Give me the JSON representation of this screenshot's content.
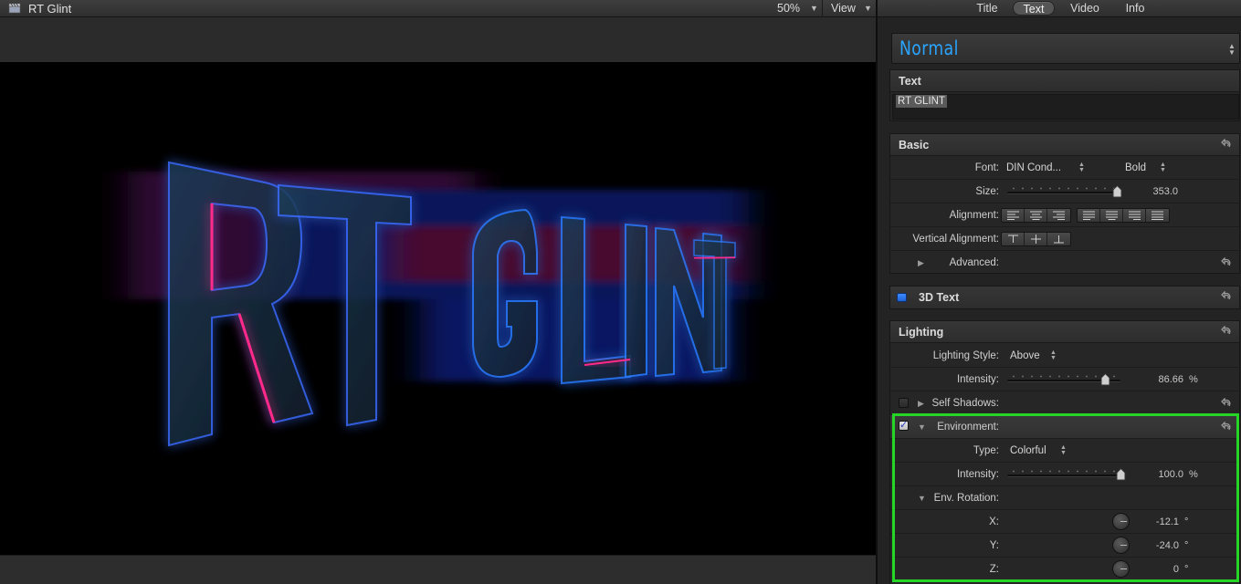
{
  "viewer": {
    "title": "RT Glint",
    "zoom": "50%",
    "view_label": "View",
    "canvas_text": "RT GLINT"
  },
  "inspector": {
    "tabs": [
      {
        "label": "Title",
        "active": false
      },
      {
        "label": "Text",
        "active": true
      },
      {
        "label": "Video",
        "active": false
      },
      {
        "label": "Info",
        "active": false
      }
    ],
    "style_preset": "Normal",
    "text_section": {
      "title": "Text",
      "content": "RT GLINT"
    },
    "basic": {
      "title": "Basic",
      "font_label": "Font:",
      "font_value": "DIN Cond...",
      "weight_value": "Bold",
      "size_label": "Size:",
      "size_value": "353.0",
      "size_fraction": 0.97,
      "alignment_label": "Alignment:",
      "vertical_alignment_label": "Vertical Alignment:",
      "advanced_label": "Advanced:"
    },
    "three_d_text": {
      "title": "3D Text",
      "enabled": true
    },
    "lighting": {
      "title": "Lighting",
      "style_label": "Lighting Style:",
      "style_value": "Above",
      "intensity_label": "Intensity:",
      "intensity_value": "86.66",
      "intensity_unit": "%",
      "intensity_fraction": 0.8666,
      "self_shadows_label": "Self Shadows:",
      "self_shadows_checked": false,
      "environment_label": "Environment:",
      "environment_checked": true
    },
    "environment": {
      "type_label": "Type:",
      "type_value": "Colorful",
      "intensity_label": "Intensity:",
      "intensity_value": "100.0",
      "intensity_unit": "%",
      "intensity_fraction": 1.0,
      "rotation_label": "Env. Rotation:",
      "x_label": "X:",
      "x_value": "-12.1",
      "y_label": "Y:",
      "y_value": "-24.0",
      "z_label": "Z:",
      "z_value": "0",
      "degree_unit": "°"
    },
    "colors": {
      "accent_blue": "#2aa5ff",
      "highlight_green": "#26d626"
    }
  }
}
